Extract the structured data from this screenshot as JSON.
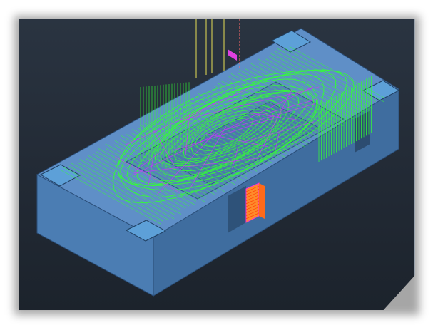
{
  "scene": {
    "view": "isometric",
    "model": "mold-block-with-toolpath",
    "colors": {
      "background": "#252e3a",
      "block_top": "#5e8fc6",
      "block_side": "#4d7fb4",
      "block_front": "#426fa0",
      "toolpath": "#33ff33",
      "toolpath_accent": "#cc33ff",
      "axis_lines": "#e8e05a",
      "marker": "#ff7f2a"
    }
  }
}
